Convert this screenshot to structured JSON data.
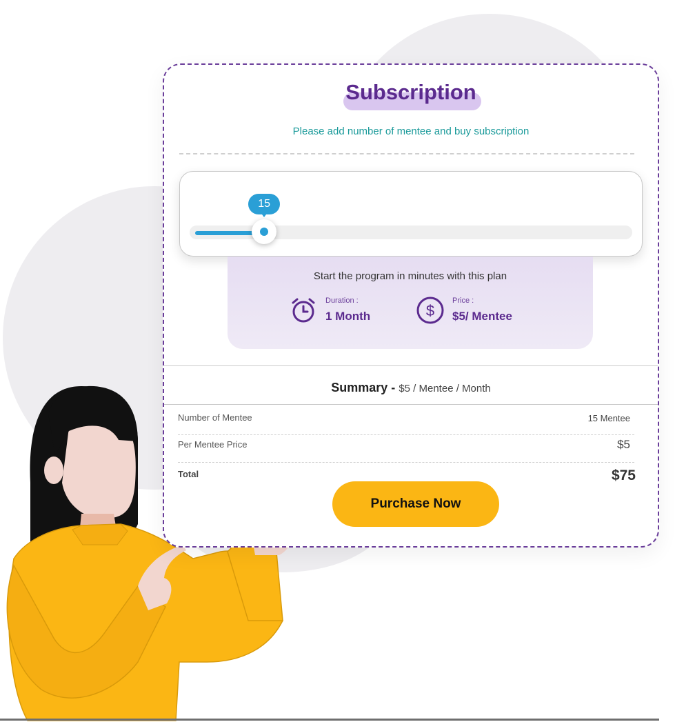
{
  "header": {
    "title": "Subscription",
    "subtitle": "Please add number of mentee and buy subscription"
  },
  "slider": {
    "value": "15",
    "fraction": 0.16
  },
  "plan": {
    "tagline": "Start the program in minutes with this plan",
    "duration": {
      "label": "Duration :",
      "value": "1 Month",
      "icon": "alarm-clock-icon"
    },
    "price": {
      "label": "Price :",
      "value": "$5/ Mentee",
      "icon": "dollar-circle-icon"
    }
  },
  "summary": {
    "heading": "Summary -",
    "rate": "$5 / Mentee / Month",
    "rows": [
      {
        "label": "Number of Mentee",
        "value": "15 Mentee"
      },
      {
        "label": "Per Mentee Price",
        "value": "$5"
      },
      {
        "label": "Total",
        "value": "$75"
      }
    ]
  },
  "actions": {
    "purchase_label": "Purchase Now"
  },
  "colors": {
    "brand_purple": "#5b2a8e",
    "accent_teal": "#1a9a9a",
    "slider_blue": "#2a9fd6",
    "button_yellow": "#fbb614"
  }
}
